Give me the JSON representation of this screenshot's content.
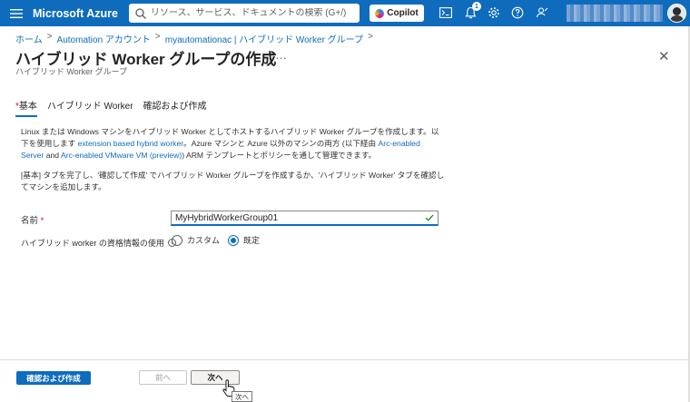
{
  "topbar": {
    "brand": "Microsoft Azure",
    "search_placeholder": "リソース、サービス、ドキュメントの検索 (G+/)",
    "copilot_label": "Copilot",
    "notification_count": "1",
    "icons": [
      "hamburger-icon",
      "search-icon",
      "cloud-shell-icon",
      "bell-icon",
      "gear-icon",
      "help-icon",
      "feedback-icon"
    ]
  },
  "breadcrumb": {
    "items": [
      "ホーム",
      "Automation アカウント",
      "myautomationac | ハイブリッド Worker グループ"
    ],
    "separator": ">"
  },
  "page": {
    "title": "ハイブリッド Worker グループの作成",
    "more": "…",
    "subtitle": "ハイブリッド Worker グループ",
    "close": "✕"
  },
  "tabs": [
    {
      "label": "基本",
      "required_mark": "*",
      "active": true
    },
    {
      "label": "ハイブリッド Worker",
      "active": false
    },
    {
      "label": "確認および作成",
      "active": false
    }
  ],
  "description": {
    "part1": "Linux または Windows マシンをハイブリッド Worker としてホストするハイブリッド Worker グループを作成します。以下を使用します",
    "link1": "extension based hybrid worker",
    "part2": "。Azure マシンと Azure 以外のマシンの両方 (以下経由",
    "link2": "Arc-enabled Server",
    "part3": "and",
    "link3": "Arc-enabled VMware VM (preview)",
    "part4": ") ARM テンプレートとポリシーを通して管理できます。"
  },
  "note": "[基本] タブを完了し、'確認して作成' でハイブリッド Worker グループを作成するか、'ハイブリッド Worker' タブを確認してマシンを追加します。",
  "form": {
    "name_label": "名前",
    "name_required": "*",
    "name_value": "MyHybridWorkerGroup01",
    "cred_label": "ハイブリッド worker の資格情報の使用",
    "cred_options": [
      {
        "label": "カスタム",
        "selected": false
      },
      {
        "label": "既定",
        "selected": true
      }
    ]
  },
  "footer": {
    "review_label": "確認および作成",
    "prev_label": "前へ",
    "next_label": "次へ",
    "tooltip": "次へ"
  },
  "colors": {
    "accent": "#0f6cbd",
    "required": "#c50f1f",
    "valid": "#107c10"
  }
}
